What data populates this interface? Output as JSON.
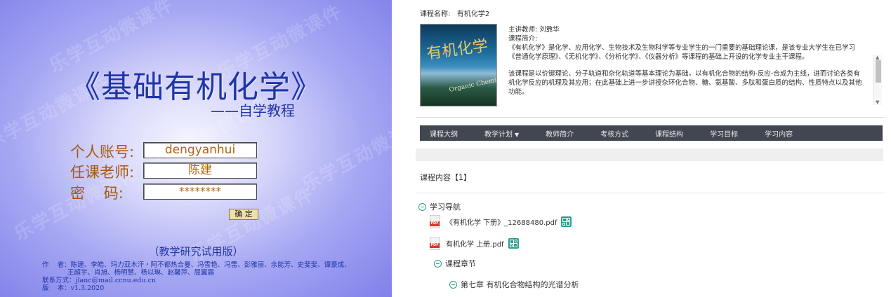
{
  "login": {
    "watermark": "乐学互动微课件",
    "title": "《基础有机化学》",
    "subtitle": "——自学教程",
    "account_label": "个人账号:",
    "account_value": "dengyanhui",
    "teacher_label": "任课老师:",
    "teacher_value": "陈建",
    "password_label": "密    码:",
    "password_value": "********",
    "confirm_label": "确 定",
    "edition": "（教学研究试用版）",
    "authors_line1": "作    者：陈建、李皓、玛力亚木汗・阿不都热合曼、冯雪艳、冯雷、彭雅丽、余能芳、史斐斐、谭豪成、",
    "authors_line2": "王超宇、肖旭、杨明慧、杨以琳、赵馨萍、屈翼霜",
    "contact": "联系方式：jlanc@mail.ccnu.edu.cn",
    "version": "版    本：v1.3.2020"
  },
  "course": {
    "name_label": "课程名称:",
    "name_value": "有机化学2",
    "teacher_label": "主讲教师:",
    "teacher_value": "刘鼐华",
    "intro_label": "课程简介:",
    "intro_p1": "《有机化学》是化学、应用化学、生物技术及生物科学等专业学生的一门重要的基础理论课，是该专业大学生在已学习《普通化学原理》、《无机化学》、《分析化学》、《仪器分析》等课程的基础上开设的化学专业主干课程。",
    "intro_p2": "该课程是以价键理论、分子轨道和杂化轨道等基本理论为基础，以有机化合物的结构-反应-合成为主线，进而讨论各类有机化学反应的机理及其应用；在此基础上进一步讲授杂环化合物、糖、氨基酸、多肽和蛋白质的结构、性质特点以及其他功能。",
    "cover_title_cn": "有机化学",
    "cover_title_en": "Organic Chemistry"
  },
  "nav": {
    "items": [
      "课程大纲",
      "教学计划",
      "教师简介",
      "考核方式",
      "课程结构",
      "学习目标",
      "学习内容"
    ]
  },
  "content": {
    "heading": "课程内容【1】",
    "tree": {
      "guide_label": "学习导航",
      "file1": "《有机化学 下册》_12688480.pdf",
      "file2": "有机化学 上册.pdf",
      "chapters_label": "课程章节",
      "chapter7": "第七章 有机化合物结构的光谱分析"
    }
  },
  "colors": {
    "login_title": "#1f35a8",
    "login_label": "#a45a10",
    "nav_bg": "#424650",
    "accent": "#2f9c8c",
    "pdf_red": "#d9382c"
  }
}
